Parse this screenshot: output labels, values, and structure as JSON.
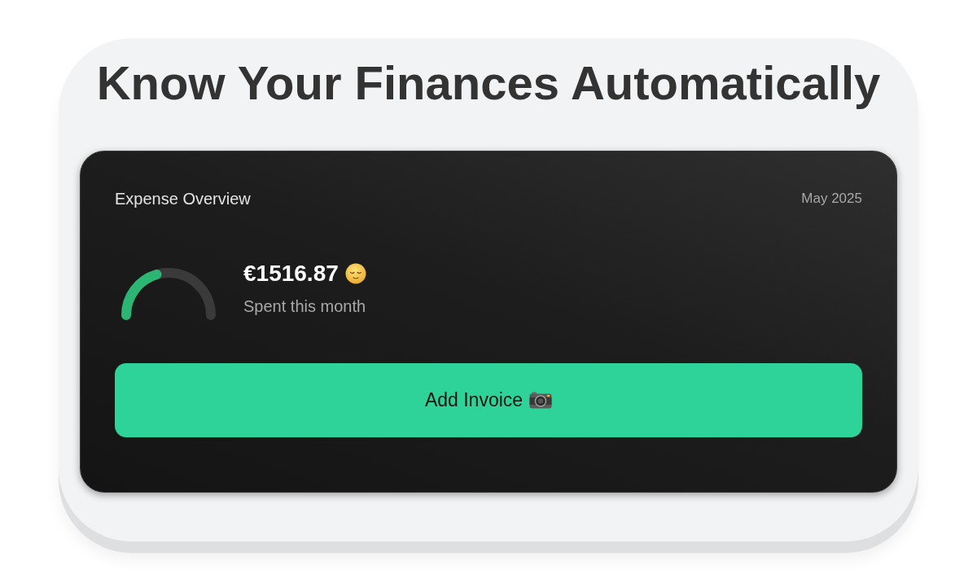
{
  "headline": "Know Your Finances Automatically",
  "card": {
    "title": "Expense Overview",
    "period": "May 2025",
    "gauge": {
      "level": 0.41
    },
    "amount": "€1516.87",
    "caption": "Spent this month",
    "button": {
      "label": "Add Invoice"
    }
  }
}
